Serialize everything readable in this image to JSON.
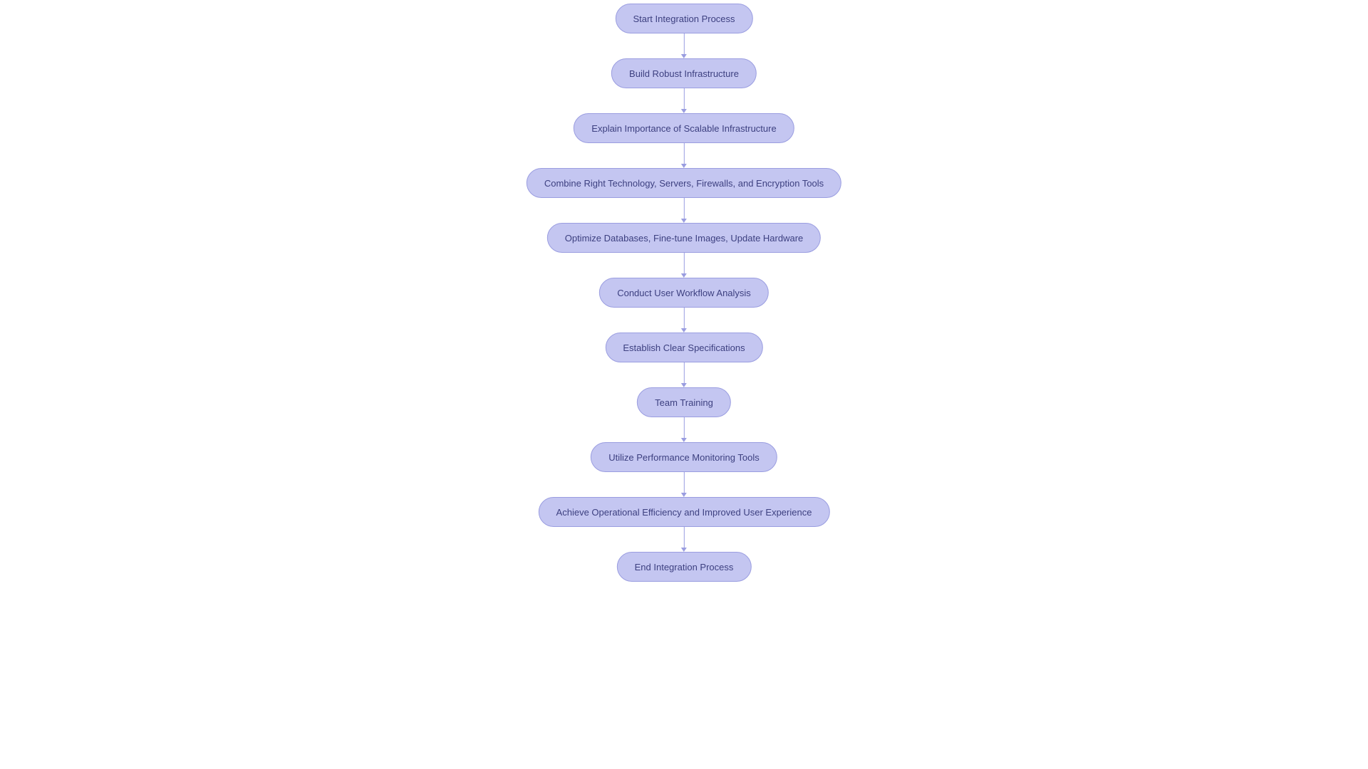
{
  "nodes": [
    {
      "label": "Start Integration Process"
    },
    {
      "label": "Build Robust Infrastructure"
    },
    {
      "label": "Explain Importance of Scalable Infrastructure"
    },
    {
      "label": "Combine Right Technology, Servers, Firewalls, and Encryption Tools"
    },
    {
      "label": "Optimize Databases, Fine-tune Images, Update Hardware"
    },
    {
      "label": "Conduct User Workflow Analysis"
    },
    {
      "label": "Establish Clear Specifications"
    },
    {
      "label": "Team Training"
    },
    {
      "label": "Utilize Performance Monitoring Tools"
    },
    {
      "label": "Achieve Operational Efficiency and Improved User Experience"
    },
    {
      "label": "End Integration Process"
    }
  ],
  "colors": {
    "node_fill": "#c4c6f1",
    "node_border": "#9a9de0",
    "node_text": "#3d4080",
    "connector": "#9a9de0",
    "background": "#ffffff"
  }
}
